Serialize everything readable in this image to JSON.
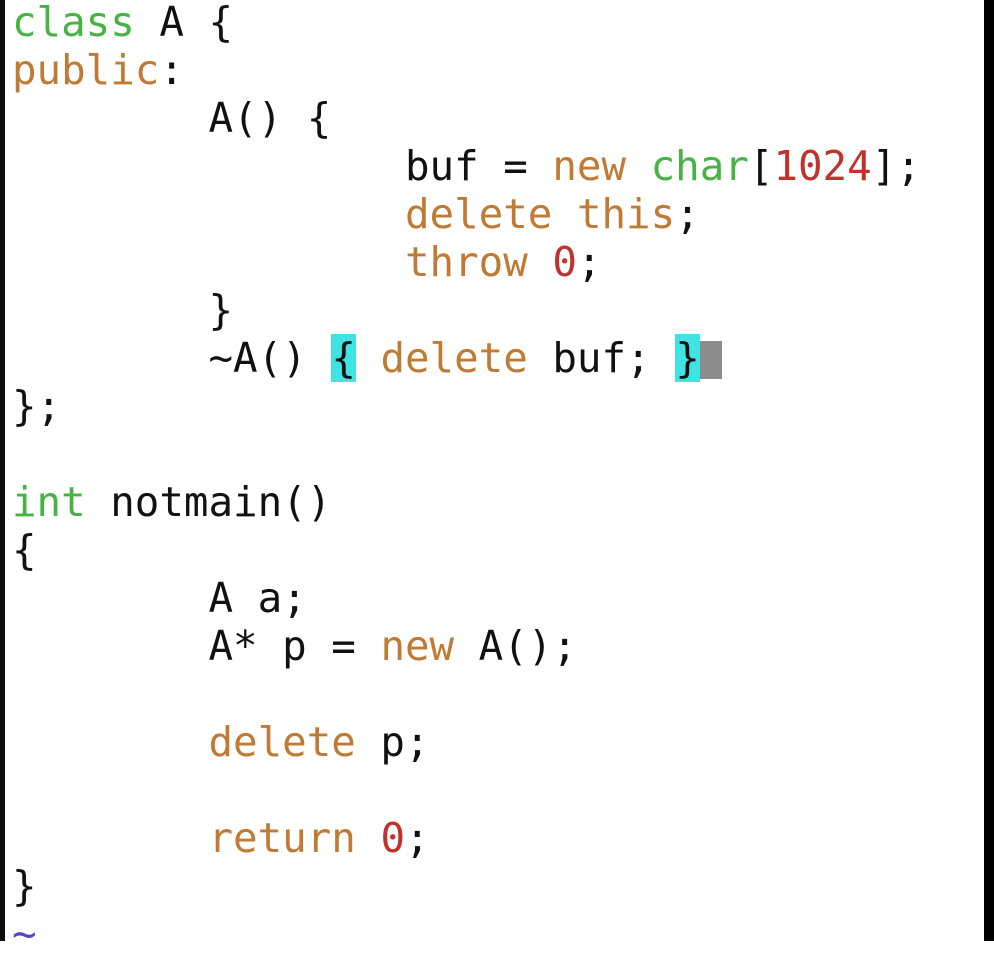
{
  "theme": {
    "keyword_green": "#46b444",
    "keyword_orange": "#c07a33",
    "literal_red": "#c0322b",
    "plain_text": "#111111",
    "bracket_match": "#40e3e3",
    "cursor": "#8c8c8c",
    "tilde_line": "#5544cc"
  },
  "code": {
    "lines": [
      [
        {
          "t": "class",
          "c": "green"
        },
        {
          "t": " A {",
          "c": "plain"
        }
      ],
      [
        {
          "t": "public",
          "c": "orange"
        },
        {
          "t": ":",
          "c": "plain"
        }
      ],
      [
        {
          "t": "        A() {",
          "c": "plain"
        }
      ],
      [
        {
          "t": "                buf = ",
          "c": "plain"
        },
        {
          "t": "new",
          "c": "orange"
        },
        {
          "t": " ",
          "c": "plain"
        },
        {
          "t": "char",
          "c": "green"
        },
        {
          "t": "[",
          "c": "plain"
        },
        {
          "t": "1024",
          "c": "red"
        },
        {
          "t": "];",
          "c": "plain"
        }
      ],
      [
        {
          "t": "                ",
          "c": "plain"
        },
        {
          "t": "delete",
          "c": "orange"
        },
        {
          "t": " ",
          "c": "plain"
        },
        {
          "t": "this",
          "c": "orange"
        },
        {
          "t": ";",
          "c": "plain"
        }
      ],
      [
        {
          "t": "                ",
          "c": "plain"
        },
        {
          "t": "throw",
          "c": "orange"
        },
        {
          "t": " ",
          "c": "plain"
        },
        {
          "t": "0",
          "c": "red"
        },
        {
          "t": ";",
          "c": "plain"
        }
      ],
      [
        {
          "t": "        }",
          "c": "plain"
        }
      ],
      [
        {
          "t": "        ~A() ",
          "c": "plain"
        },
        {
          "t": "{",
          "c": "plain",
          "match": true
        },
        {
          "t": " ",
          "c": "plain"
        },
        {
          "t": "delete",
          "c": "orange"
        },
        {
          "t": " buf; ",
          "c": "plain"
        },
        {
          "t": "}",
          "c": "plain",
          "match": true
        },
        {
          "cursor": true
        }
      ],
      [
        {
          "t": "};",
          "c": "plain"
        }
      ],
      [
        {
          "t": "",
          "c": "plain"
        }
      ],
      [
        {
          "t": "int",
          "c": "green"
        },
        {
          "t": " notmain()",
          "c": "plain"
        }
      ],
      [
        {
          "t": "{",
          "c": "plain"
        }
      ],
      [
        {
          "t": "        A a;",
          "c": "plain"
        }
      ],
      [
        {
          "t": "        A* p = ",
          "c": "plain"
        },
        {
          "t": "new",
          "c": "orange"
        },
        {
          "t": " A();",
          "c": "plain"
        }
      ],
      [
        {
          "t": "",
          "c": "plain"
        }
      ],
      [
        {
          "t": "        ",
          "c": "plain"
        },
        {
          "t": "delete",
          "c": "orange"
        },
        {
          "t": " p;",
          "c": "plain"
        }
      ],
      [
        {
          "t": "",
          "c": "plain"
        }
      ],
      [
        {
          "t": "        ",
          "c": "plain"
        },
        {
          "t": "return",
          "c": "orange"
        },
        {
          "t": " ",
          "c": "plain"
        },
        {
          "t": "0",
          "c": "red"
        },
        {
          "t": ";",
          "c": "plain"
        }
      ],
      [
        {
          "t": "}",
          "c": "plain"
        }
      ],
      [
        {
          "t": "~",
          "c": "tilde"
        }
      ]
    ]
  }
}
